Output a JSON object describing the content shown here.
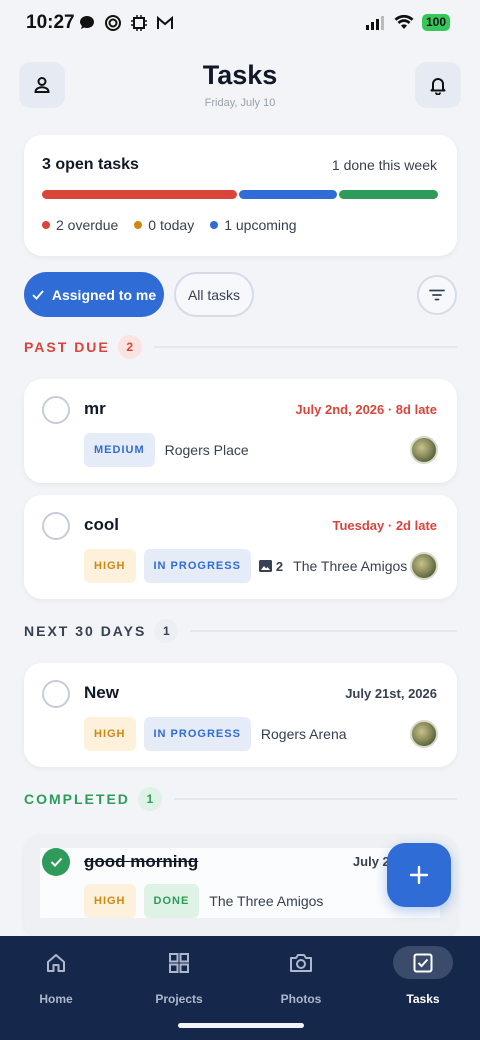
{
  "status_bar": {
    "time": "10:27",
    "battery": "100"
  },
  "header": {
    "title": "Tasks",
    "date": "Friday, July 10"
  },
  "summary": {
    "open_tasks": "3 open tasks",
    "done_this_week": "1 done this week",
    "legend": [
      {
        "label": "2 overdue",
        "color": "#d9453b"
      },
      {
        "label": "0 today",
        "color": "#d08612"
      },
      {
        "label": "1 upcoming",
        "color": "#2f6cd6"
      }
    ],
    "bar_colors": {
      "overdue": "#d9453b",
      "upcoming": "#2f6cd6",
      "done": "#2e9b5b"
    }
  },
  "filters": {
    "assigned": "Assigned to me",
    "all": "All tasks"
  },
  "sections": {
    "past_due": {
      "label": "PAST DUE",
      "count": "2"
    },
    "next_30": {
      "label": "NEXT 30 DAYS",
      "count": "1"
    },
    "completed": {
      "label": "COMPLETED",
      "count": "1"
    }
  },
  "tasks": [
    {
      "name": "mr",
      "due": "July 2nd, 2026 · 8d late",
      "priority": "MEDIUM",
      "location": "Rogers Place"
    },
    {
      "name": "cool",
      "due": "Tuesday · 2d late",
      "priority": "HIGH",
      "status": "IN PROGRESS",
      "photos": "2",
      "location": "The Three Amigos"
    },
    {
      "name": "New",
      "due": "July 21st, 2026",
      "priority": "HIGH",
      "status": "IN PROGRESS",
      "location": "Rogers Arena"
    },
    {
      "name": "good morning",
      "due": "July 23",
      "priority": "HIGH",
      "status": "DONE",
      "location": "The Three Amigos"
    }
  ],
  "nav": [
    {
      "label": "Home",
      "icon": "home-icon"
    },
    {
      "label": "Projects",
      "icon": "grid-icon"
    },
    {
      "label": "Photos",
      "icon": "camera-icon"
    },
    {
      "label": "Tasks",
      "icon": "checkbox-icon"
    }
  ]
}
